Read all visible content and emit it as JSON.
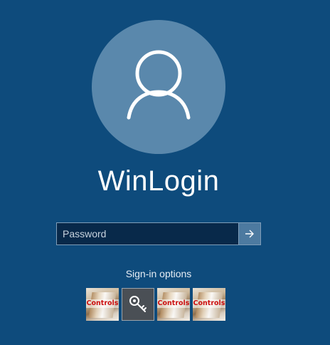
{
  "account": {
    "username": "WinLogin"
  },
  "password_field": {
    "placeholder": "Password",
    "value": ""
  },
  "submit_icon": "arrow-right-icon",
  "signin_options": {
    "label": "Sign-in options",
    "options": [
      {
        "icon": "picture-password-icon",
        "label": "Controls"
      },
      {
        "icon": "key-icon",
        "label": ""
      },
      {
        "icon": "picture-password-icon",
        "label": "Controls"
      },
      {
        "icon": "picture-password-icon",
        "label": "Controls"
      }
    ]
  },
  "colors": {
    "background": "#0e4b7c",
    "avatar_circle": "#5a88ac",
    "input_background": "#08294a",
    "submit_button": "#4d7aa0",
    "option_label_text": "#cc1010"
  }
}
